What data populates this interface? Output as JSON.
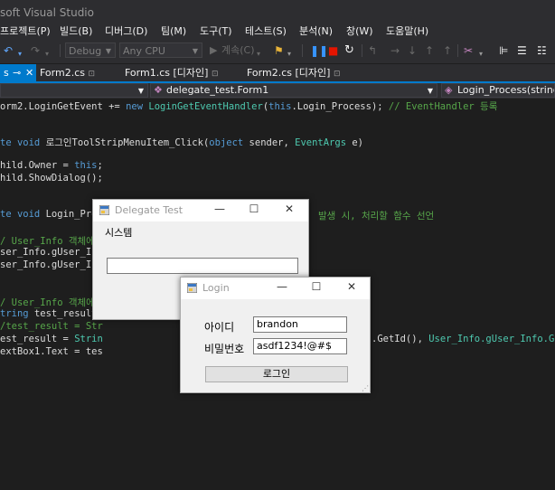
{
  "window": {
    "title": "soft Visual Studio"
  },
  "menu": [
    "프로젝트(P)",
    "빌드(B)",
    "디버그(D)",
    "팀(M)",
    "도구(T)",
    "테스트(S)",
    "분석(N)",
    "창(W)",
    "도움말(H)"
  ],
  "toolbar": {
    "config": "Debug",
    "platform": "Any CPU",
    "continue_label": "계속(C)"
  },
  "tabs": [
    "Form2.cs",
    "Form1.cs [디자인]",
    "Form2.cs [디자인]"
  ],
  "nav": {
    "class_combo": "delegate_test.Form1",
    "member_combo": "Login_Process(string id,"
  },
  "code": {
    "line1_a": "orm2.LoginGetEvent += ",
    "line1_kw": "new ",
    "line1_type": "LoginGetEventHandler",
    "line1_b": "(",
    "line1_kw2": "this",
    "line1_c": ".Login_Process); ",
    "line1_cm": "// EventHandler 등록",
    "line2_kw": "te void ",
    "line2_b": "로그인ToolStripMenuItem_Click(",
    "line2_kw2": "object ",
    "line2_c": "sender, ",
    "line2_type": "EventArgs ",
    "line2_d": "e)",
    "line3_a": "hild.Owner = ",
    "line3_kw": "this",
    "line3_b": ";",
    "line4": "hild.ShowDialog();",
    "line5_kw": "te void ",
    "line5_b": "Login_Proce",
    "line5_cm": "발생 시, 처리할 함수 선언",
    "line6_cm": "/ User_Info 객체에",
    "line7": "ser_Info.gUser_Inf",
    "line8": "ser_Info.gUser_Inf",
    "line9_cm": "/ User_Info 객체에",
    "line10_kw": "tring ",
    "line10_b": "test_result",
    "line11_cm": "/test_result = Str",
    "line12_a": "est_result = ",
    "line12_ty": "Strin",
    "line12_right_a": ".GetId(), ",
    "line12_right_b": "User_Info.gUser_Info.GetP",
    "line13": "extBox1.Text = tes"
  },
  "delegate_window": {
    "title": "Delegate Test",
    "menu_item": "시스템",
    "textbox_value": ""
  },
  "login_window": {
    "title": "Login",
    "id_label": "아이디",
    "id_value": "brandon",
    "pw_label": "비밀번호",
    "pw_value": "asdf1234!@#$",
    "login_button": "로그인"
  }
}
